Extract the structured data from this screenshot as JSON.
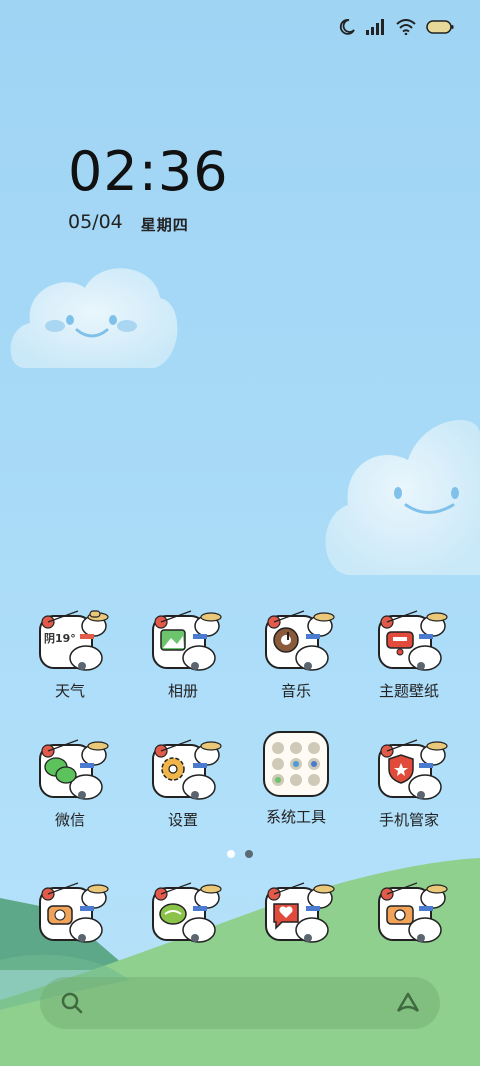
{
  "status_bar": {
    "icons": [
      "moon-icon",
      "signal-icon",
      "wifi-icon",
      "battery-icon"
    ]
  },
  "clock": {
    "time": "02:36",
    "date": "05/04",
    "weekday": "星期四"
  },
  "apps_row1": [
    {
      "label": "天气",
      "icon": "weather-icon",
      "extra": "阴19°"
    },
    {
      "label": "相册",
      "icon": "gallery-icon"
    },
    {
      "label": "音乐",
      "icon": "music-icon"
    },
    {
      "label": "主题壁纸",
      "icon": "themes-icon"
    }
  ],
  "apps_row2": [
    {
      "label": "微信",
      "icon": "wechat-icon"
    },
    {
      "label": "设置",
      "icon": "settings-icon"
    },
    {
      "label": "系统工具",
      "icon": "folder-icon"
    },
    {
      "label": "手机管家",
      "icon": "security-icon"
    }
  ],
  "dock": [
    {
      "icon": "phone-icon"
    },
    {
      "icon": "messages-icon"
    },
    {
      "icon": "browser-icon"
    },
    {
      "icon": "camera-icon"
    }
  ],
  "page_indicator": {
    "count": 2,
    "active": 0
  },
  "search_bar": {
    "icons": [
      "search-icon",
      "assistant-icon"
    ]
  },
  "colors": {
    "sky": "#a7daf7",
    "hill": "#8fcf8f",
    "dark_hill": "#5ea88a",
    "accent_red": "#e14b3c"
  }
}
